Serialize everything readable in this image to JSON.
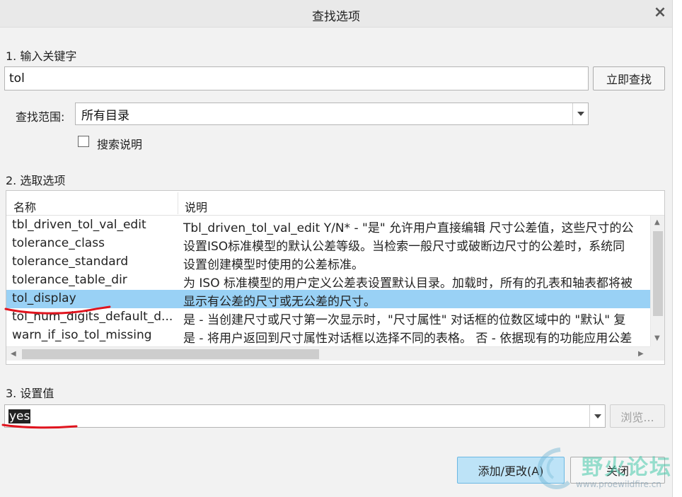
{
  "dialog": {
    "title": "查找选项",
    "close_glyph": "×"
  },
  "step1": {
    "label": "1. 输入关键字",
    "keyword_value": "tol",
    "search_button": "立即查找",
    "scope_label": "查找范围:",
    "scope_value": "所有目录",
    "search_desc_label": "搜索说明",
    "search_desc_checked": false
  },
  "step2": {
    "label": "2. 选取选项",
    "columns": [
      "名称",
      "说明"
    ],
    "rows": [
      {
        "name": "tbl_driven_tol_val_edit",
        "desc": "Tbl_driven_tol_val_edit Y/N* - \"是\" 允许用户直接编辑 尺寸公差值，这些尺寸的公"
      },
      {
        "name": "tolerance_class",
        "desc": "设置ISO标准模型的默认公差等级。当检索一般尺寸或破断边尺寸的公差时，系统同"
      },
      {
        "name": "tolerance_standard",
        "desc": "设置创建模型时使用的公差标准。"
      },
      {
        "name": "tolerance_table_dir",
        "desc": "为 ISO 标准模型的用户定义公差表设置默认目录。加载时，所有的孔表和轴表都将被"
      },
      {
        "name": "tol_display",
        "desc": "显示有公差的尺寸或无公差的尺寸。",
        "selected": true
      },
      {
        "name": "tol_num_digits_default_d...",
        "desc": "是 - 当创建尺寸或尺寸第一次显示时，\"尺寸属性\" 对话框的位数区域中的 \"默认\" 复"
      },
      {
        "name": "warn_if_iso_tol_missing",
        "desc": "是 - 将用户返回到尺寸属性对话框以选择不同的表格。 否 - 依据现有的功能应用公差"
      }
    ]
  },
  "step3": {
    "label": "3. 设置值",
    "value": "yes",
    "browse_button": "浏览..."
  },
  "footer": {
    "add_button": "添加/更改(A)",
    "close_button": "关闭"
  },
  "watermark": {
    "text": "野火论坛",
    "url": "www.proewildfire.cn"
  },
  "annotations": {
    "underline_color": "#e0141e"
  }
}
